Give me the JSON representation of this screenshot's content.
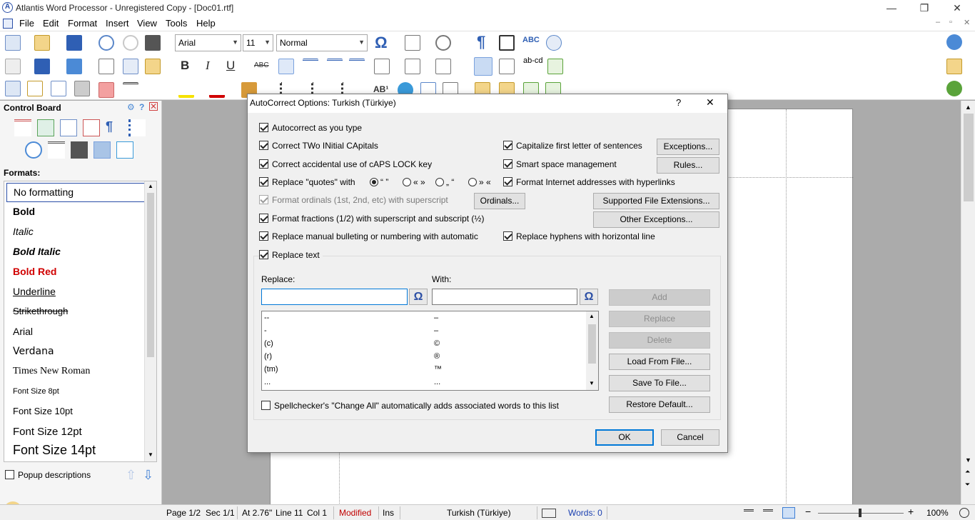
{
  "app": {
    "title": "Atlantis Word Processor - Unregistered Copy - [Doc01.rtf]",
    "icon": "atlantis-logo-icon",
    "window_controls": [
      "—",
      "❐",
      "✕"
    ]
  },
  "menu": {
    "items": [
      "File",
      "Edit",
      "Format",
      "Insert",
      "View",
      "Tools",
      "Help"
    ]
  },
  "toolbar": {
    "font": "Arial",
    "size": "11",
    "style": "Normal",
    "bold": "B",
    "italic": "I",
    "underline": "U",
    "strike": "ABC",
    "abc_check": "ABC",
    "abcd": "ab-cd",
    "ab1": "AB¹",
    "omega": "Ω",
    "pilcrow": "¶"
  },
  "control_board": {
    "title": "Control Board",
    "formats_label": "Formats:",
    "formats": [
      {
        "label": "No formatting"
      },
      {
        "label": "Bold"
      },
      {
        "label": "Italic"
      },
      {
        "label": "Bold Italic"
      },
      {
        "label": "Bold Red"
      },
      {
        "label": "Underline"
      },
      {
        "label": "Strikethrough"
      },
      {
        "label": "Arial"
      },
      {
        "label": "Verdana"
      },
      {
        "label": "Times New Roman"
      },
      {
        "label": "Font Size 8pt"
      },
      {
        "label": "Font Size 10pt"
      },
      {
        "label": "Font Size 12pt"
      },
      {
        "label": "Font Size 14pt"
      }
    ],
    "popup_descriptions": "Popup descriptions"
  },
  "status": {
    "page": "Page 1/2",
    "sec": "Sec 1/1",
    "at": "At 2.76\"",
    "line": "Line 11",
    "col": "Col 1",
    "modified": "Modified",
    "ins": "Ins",
    "language": "Turkish (Türkiye)",
    "words": "Words: 0",
    "zoom": "100%",
    "modified_color": "#c00000",
    "words_color": "#1a3fb0"
  },
  "dialog": {
    "title": "AutoCorrect Options: Turkish (Türkiye)",
    "help": "?",
    "close": "✕",
    "options": {
      "autocorrect_as_you_type": "Autocorrect as you type",
      "correct_two_initial": "Correct TWo INitial CApitals",
      "correct_caps_lock": "Correct accidental use of cAPS LOCK key",
      "replace_quotes": "Replace \"quotes\" with",
      "format_ordinals": "Format ordinals (1st, 2nd, etc) with superscript",
      "format_fractions": "Format fractions (1/2) with superscript and subscript (½)",
      "replace_bulleting": "Replace manual bulleting or numbering with automatic",
      "capitalize_first": "Capitalize first letter of sentences",
      "smart_space": "Smart space management",
      "format_internet": "Format Internet addresses with hyperlinks",
      "replace_hyphens": "Replace hyphens with horizontal line",
      "replace_text": "Replace text",
      "spellchecker": "Spellchecker's \"Change All\" automatically adds associated words to this list"
    },
    "quote_styles": [
      "“ ”",
      "« »",
      "„ “",
      "» «"
    ],
    "buttons": {
      "exceptions": "Exceptions...",
      "rules": "Rules...",
      "ordinals": "Ordinals...",
      "supported_ext": "Supported File Extensions...",
      "other_exceptions": "Other Exceptions...",
      "add": "Add",
      "replace": "Replace",
      "delete": "Delete",
      "load": "Load From File...",
      "save": "Save To File...",
      "restore": "Restore Default...",
      "ok": "OK",
      "cancel": "Cancel"
    },
    "replace_label": "Replace:",
    "with_label": "With:",
    "replace_value": "",
    "with_value": "",
    "omega": "Ω",
    "entries": [
      {
        "from": "--",
        "to": "–"
      },
      {
        "from": "-",
        "to": "–"
      },
      {
        "from": "(c)",
        "to": "©"
      },
      {
        "from": "(r)",
        "to": "®"
      },
      {
        "from": "(tm)",
        "to": "™"
      },
      {
        "from": "...",
        "to": "..."
      }
    ]
  }
}
